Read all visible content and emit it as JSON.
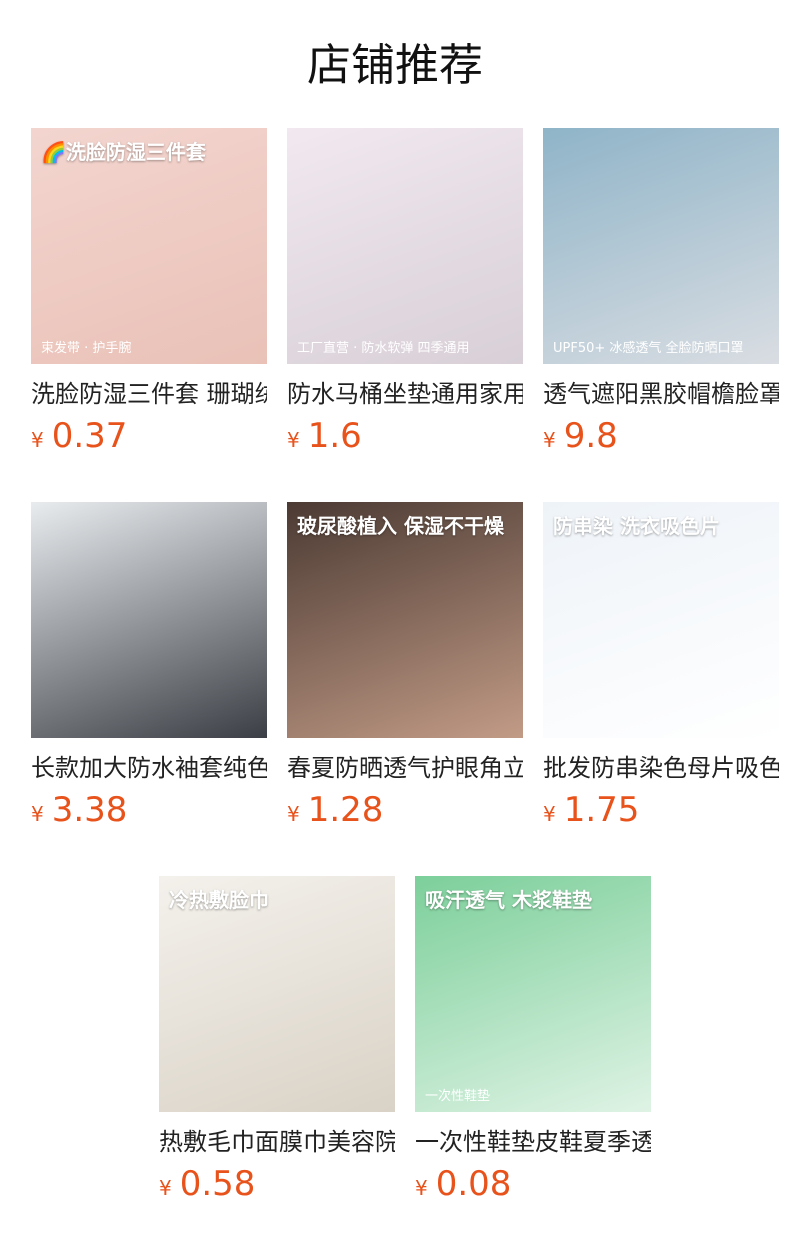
{
  "page": {
    "title": "店铺推荐"
  },
  "colors": {
    "price": "#e8521b",
    "title": "#111111"
  },
  "currency_symbol": "¥",
  "products": [
    {
      "name": "洗脸防湿三件套 珊瑚绒",
      "price": "0.37",
      "image_text": {
        "top": "🌈洗脸防湿三件套",
        "bottom": "束发带 · 护手腕"
      },
      "image_colors": [
        "#f3d5cf",
        "#e9c1b7"
      ]
    },
    {
      "name": "防水马桶坐垫通用家用",
      "price": "1.6",
      "image_text": {
        "top": "",
        "bottom": "工厂直营 · 防水软弹 四季通用"
      },
      "image_colors": [
        "#f1e9ef",
        "#d8cfd7"
      ]
    },
    {
      "name": "透气遮阳黑胶帽檐脸罩",
      "price": "9.8",
      "image_text": {
        "top": "",
        "bottom": "UPF50+ 冰感透气 全脸防晒口罩"
      },
      "image_colors": [
        "#8fb4c8",
        "#d9dde2"
      ]
    },
    {
      "name": "长款加大防水袖套纯色",
      "price": "3.38",
      "image_text": {
        "top": "",
        "bottom": ""
      },
      "image_colors": [
        "#e9ecef",
        "#3b3f45"
      ]
    },
    {
      "name": "春夏防晒透气护眼角立体",
      "price": "1.28",
      "image_text": {
        "top": "玻尿酸植入 保湿不干燥",
        "bottom": ""
      },
      "image_colors": [
        "#4b3a33",
        "#c29b86"
      ]
    },
    {
      "name": "批发防串染色母片吸色",
      "price": "1.75",
      "image_text": {
        "top": "防串染 洗衣吸色片",
        "bottom": ""
      },
      "image_colors": [
        "#eef3f8",
        "#ffffff"
      ]
    },
    {
      "name": "热敷毛巾面膜巾美容院",
      "price": "0.58",
      "image_text": {
        "top": "冷热敷脸巾",
        "bottom": ""
      },
      "image_colors": [
        "#f4f1ec",
        "#d9d2c6"
      ]
    },
    {
      "name": "一次性鞋垫皮鞋夏季透气",
      "price": "0.08",
      "image_text": {
        "top": "吸汗透气 木浆鞋垫",
        "bottom": "一次性鞋垫"
      },
      "image_colors": [
        "#7ccf9a",
        "#dff3e5"
      ]
    }
  ]
}
